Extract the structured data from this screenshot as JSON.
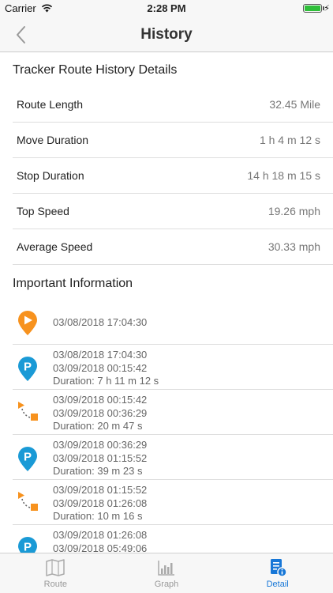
{
  "status_bar": {
    "carrier": "Carrier",
    "time": "2:28 PM"
  },
  "nav": {
    "title": "History"
  },
  "details": {
    "header": "Tracker Route History Details",
    "rows": [
      {
        "label": "Route Length",
        "value": "32.45 Mile"
      },
      {
        "label": "Move Duration",
        "value": "1 h 4 m 12 s"
      },
      {
        "label": "Stop Duration",
        "value": "14 h 18 m 15 s"
      },
      {
        "label": "Top Speed",
        "value": "19.26 mph"
      },
      {
        "label": "Average Speed",
        "value": "30.33 mph"
      }
    ]
  },
  "info": {
    "header": "Important Information",
    "events": [
      {
        "type": "start",
        "icon": "play-pin-icon",
        "lines": [
          "03/08/2018 17:04:30"
        ]
      },
      {
        "type": "parking",
        "icon": "parking-pin-icon",
        "lines": [
          "03/08/2018 17:04:30",
          "03/09/2018 00:15:42",
          "Duration: 7 h 11 m 12 s"
        ]
      },
      {
        "type": "move",
        "icon": "route-move-icon",
        "lines": [
          "03/09/2018 00:15:42",
          "03/09/2018 00:36:29",
          "Duration: 20 m 47 s"
        ]
      },
      {
        "type": "parking",
        "icon": "parking-pin-icon",
        "lines": [
          "03/09/2018 00:36:29",
          "03/09/2018 01:15:52",
          "Duration: 39 m 23 s"
        ]
      },
      {
        "type": "move",
        "icon": "route-move-icon",
        "lines": [
          "03/09/2018 01:15:52",
          "03/09/2018 01:26:08",
          "Duration: 10 m 16 s"
        ]
      },
      {
        "type": "parking",
        "icon": "parking-pin-icon",
        "lines": [
          "03/09/2018 01:26:08",
          "03/09/2018 05:49:06",
          ""
        ]
      }
    ]
  },
  "tabs": [
    {
      "label": "Route",
      "icon": "map-icon",
      "active": false
    },
    {
      "label": "Graph",
      "icon": "bar-chart-icon",
      "active": false
    },
    {
      "label": "Detail",
      "icon": "detail-document-icon",
      "active": true
    }
  ],
  "colors": {
    "accent": "#1777d7",
    "start_orange": "#f7921e",
    "parking_blue": "#1a9ad6",
    "inactive_tab": "#999999"
  }
}
